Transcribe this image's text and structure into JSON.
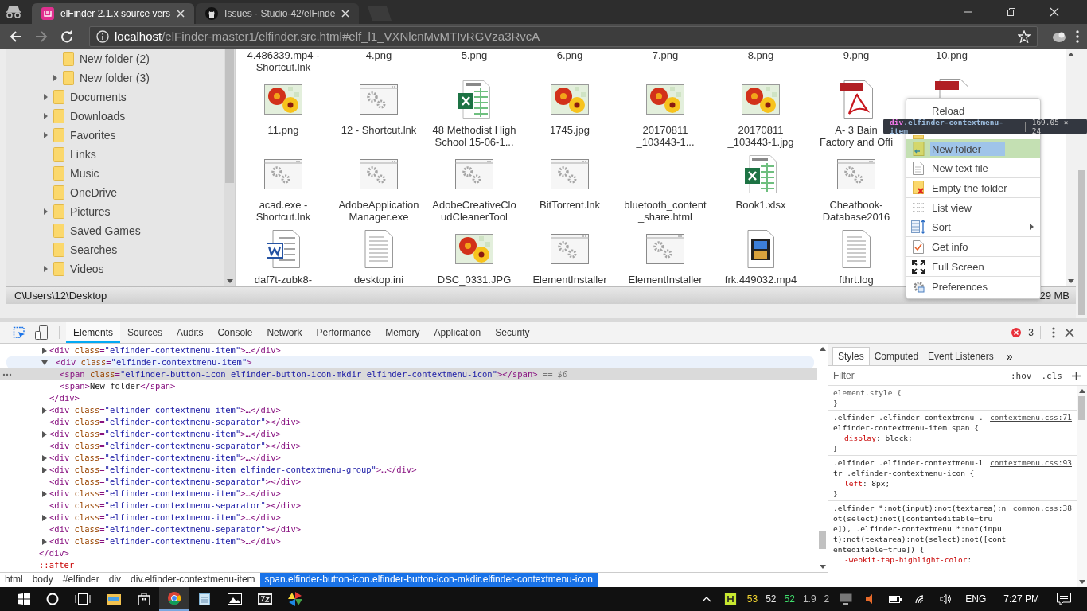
{
  "browser": {
    "tabs": [
      {
        "title": "elFinder 2.1.x source vers",
        "selected": true
      },
      {
        "title": "Issues · Studio-42/elFinde",
        "selected": false
      }
    ],
    "address": {
      "host": "localhost",
      "path": "/elFinder-master1/elfinder.src.html#elf_l1_VXNlcnMvMTIvRGVza3RvcA"
    }
  },
  "elfinder": {
    "tree": {
      "sub_items": [
        {
          "label": "New folder (2)",
          "expandable": false
        },
        {
          "label": "New folder (3)",
          "expandable": true
        }
      ],
      "items": [
        {
          "label": "Documents",
          "expandable": true
        },
        {
          "label": "Downloads",
          "expandable": true
        },
        {
          "label": "Favorites",
          "expandable": true
        },
        {
          "label": "Links",
          "expandable": false
        },
        {
          "label": "Music",
          "expandable": false
        },
        {
          "label": "OneDrive",
          "expandable": false
        },
        {
          "label": "Pictures",
          "expandable": true
        },
        {
          "label": "Saved Games",
          "expandable": false
        },
        {
          "label": "Searches",
          "expandable": false
        },
        {
          "label": "Videos",
          "expandable": true
        }
      ]
    },
    "file_rows": [
      [
        {
          "name": "4.486339.mp4 -\nShortcut.lnk",
          "kind": "scrolled"
        },
        {
          "name": "4.png",
          "kind": "scrolled"
        },
        {
          "name": "5.png",
          "kind": "scrolled"
        },
        {
          "name": "6.png",
          "kind": "scrolled"
        },
        {
          "name": "7.png",
          "kind": "scrolled"
        },
        {
          "name": "8.png",
          "kind": "scrolled"
        },
        {
          "name": "9.png",
          "kind": "scrolled"
        },
        {
          "name": "10.png",
          "kind": "scrolled"
        }
      ],
      [
        {
          "name": "11.png",
          "kind": "image"
        },
        {
          "name": "12 - Shortcut.lnk",
          "kind": "program"
        },
        {
          "name": "48 Methodist High\nSchool 15-06-1...",
          "kind": "spreadsheet"
        },
        {
          "name": "1745.jpg",
          "kind": "image"
        },
        {
          "name": "20170811\n_103443-1...",
          "kind": "image"
        },
        {
          "name": "20170811\n_103443-1.jpg",
          "kind": "image"
        },
        {
          "name": "A- 3 Bain\nFactory and Offi",
          "kind": "pdf"
        },
        {
          "kind": "pdftop"
        }
      ],
      [
        {
          "name": "acad.exe -\nShortcut.lnk",
          "kind": "program"
        },
        {
          "name": "AdobeApplication\nManager.exe",
          "kind": "program"
        },
        {
          "name": "AdobeCreativeClo\nudCleanerTool",
          "kind": "program"
        },
        {
          "name": "BitTorrent.lnk",
          "kind": "program"
        },
        {
          "name": "bluetooth_content\n_share.html",
          "kind": "none"
        },
        {
          "name": "Book1.xlsx",
          "kind": "spreadsheet"
        },
        {
          "name": "Cheatbook-\nDatabase2016",
          "kind": "program"
        }
      ],
      [
        {
          "name": "daf7t-zubk8-",
          "kind": "word"
        },
        {
          "name": "desktop.ini",
          "kind": "text"
        },
        {
          "name": "DSC_0331.JPG",
          "kind": "image"
        },
        {
          "name": "ElementInstaller",
          "kind": "program"
        },
        {
          "name": "ElementInstaller",
          "kind": "program"
        },
        {
          "name": "frk.449032.mp4",
          "kind": "video"
        },
        {
          "name": "fthrt.log",
          "kind": "text"
        }
      ]
    ],
    "status": {
      "path": "C\\Users\\12\\Desktop",
      "size": "29 MB"
    },
    "context_menu": [
      {
        "kind": "reload",
        "label": "Reload",
        "selected": false,
        "submenu": false
      },
      {
        "kind": "upload",
        "selected": false,
        "submenu": false
      },
      {
        "kind": "mkdir",
        "label": "New folder",
        "selected": true,
        "submenu": false
      },
      {
        "kind": "mkfile",
        "label": "New text file",
        "selected": false,
        "submenu": false
      },
      {
        "kind": "separator"
      },
      {
        "kind": "empty",
        "label": "Empty the folder",
        "selected": false,
        "submenu": false
      },
      {
        "kind": "separator"
      },
      {
        "kind": "view",
        "label": "List view",
        "selected": false,
        "submenu": false
      },
      {
        "kind": "sort",
        "label": "Sort",
        "selected": false,
        "submenu": true
      },
      {
        "kind": "separator"
      },
      {
        "kind": "info",
        "label": "Get info",
        "selected": false,
        "submenu": false
      },
      {
        "kind": "separator"
      },
      {
        "kind": "fullscreen",
        "label": "Full Screen",
        "selected": false,
        "submenu": false
      },
      {
        "kind": "separator"
      },
      {
        "kind": "preferences",
        "label": "Preferences",
        "selected": false,
        "submenu": false
      }
    ],
    "inspect_tooltip": {
      "tag": "div",
      "classes": ".elfinder-contextmenu-item",
      "size": "169.05 × 24"
    }
  },
  "devtools": {
    "tabs": [
      {
        "label": "Elements",
        "selected": true
      },
      {
        "label": "Sources",
        "selected": false
      },
      {
        "label": "Audits",
        "selected": false
      },
      {
        "label": "Console",
        "selected": false
      },
      {
        "label": "Network",
        "selected": false
      },
      {
        "label": "Performance",
        "selected": false
      },
      {
        "label": "Memory",
        "selected": false
      },
      {
        "label": "Application",
        "selected": false
      },
      {
        "label": "Security",
        "selected": false
      }
    ],
    "error_count": "3",
    "dom": {
      "nodes": [
        {
          "parts": [
            {
              "kind": "tag",
              "s": "<div"
            },
            {
              "kind": "attr",
              "s": " class"
            },
            {
              "kind": "tag",
              "s": "="
            },
            {
              "kind": "val",
              "s": "\"elfinder-contextmenu-item\""
            },
            {
              "kind": "tag",
              "s": ">…</div>"
            }
          ],
          "expandable": true,
          "expanded": false,
          "selected": false,
          "hovered": false
        },
        {
          "parts": [
            {
              "kind": "tag",
              "s": "<div"
            },
            {
              "kind": "attr",
              "s": " class"
            },
            {
              "kind": "tag",
              "s": "="
            },
            {
              "kind": "val",
              "s": "\"elfinder-contextmenu-item\""
            },
            {
              "kind": "tag",
              "s": ">"
            }
          ],
          "expandable": true,
          "expanded": true,
          "selected": false,
          "hovered": true,
          "children": [
            {
              "parts": [
                {
                  "kind": "tag",
                  "s": "<span"
                },
                {
                  "kind": "attr",
                  "s": " class"
                },
                {
                  "kind": "tag",
                  "s": "="
                },
                {
                  "kind": "val",
                  "s": "\"elfinder-button-icon elfinder-button-icon-mkdir elfinder-contextmenu-icon\""
                },
                {
                  "kind": "tag",
                  "s": "></span>"
                },
                {
                  "kind": "ref",
                  "s": " == $0"
                }
              ],
              "expandable": false,
              "selected": true,
              "hovered": false
            },
            {
              "parts": [
                {
                  "kind": "tag",
                  "s": "<span>"
                },
                {
                  "kind": "text",
                  "s": "New folder"
                },
                {
                  "kind": "tag",
                  "s": "</span>"
                }
              ],
              "expandable": false,
              "selected": false,
              "hovered": false
            }
          ],
          "closing": [
            {
              "kind": "tag",
              "s": "</div>"
            }
          ]
        },
        {
          "parts": [
            {
              "kind": "tag",
              "s": "<div"
            },
            {
              "kind": "attr",
              "s": " class"
            },
            {
              "kind": "tag",
              "s": "="
            },
            {
              "kind": "val",
              "s": "\"elfinder-contextmenu-item\""
            },
            {
              "kind": "tag",
              "s": ">…</div>"
            }
          ],
          "expandable": true,
          "expanded": false,
          "selected": false,
          "hovered": false
        },
        {
          "parts": [
            {
              "kind": "tag",
              "s": "<div"
            },
            {
              "kind": "attr",
              "s": " class"
            },
            {
              "kind": "tag",
              "s": "="
            },
            {
              "kind": "val",
              "s": "\"elfinder-contextmenu-separator\""
            },
            {
              "kind": "tag",
              "s": "></div>"
            }
          ],
          "expandable": false,
          "selected": false,
          "hovered": false
        },
        {
          "parts": [
            {
              "kind": "tag",
              "s": "<div"
            },
            {
              "kind": "attr",
              "s": " class"
            },
            {
              "kind": "tag",
              "s": "="
            },
            {
              "kind": "val",
              "s": "\"elfinder-contextmenu-item\""
            },
            {
              "kind": "tag",
              "s": ">…</div>"
            }
          ],
          "expandable": true,
          "expanded": false,
          "selected": false,
          "hovered": false
        },
        {
          "parts": [
            {
              "kind": "tag",
              "s": "<div"
            },
            {
              "kind": "attr",
              "s": " class"
            },
            {
              "kind": "tag",
              "s": "="
            },
            {
              "kind": "val",
              "s": "\"elfinder-contextmenu-separator\""
            },
            {
              "kind": "tag",
              "s": "></div>"
            }
          ],
          "expandable": false,
          "selected": false,
          "hovered": false
        },
        {
          "parts": [
            {
              "kind": "tag",
              "s": "<div"
            },
            {
              "kind": "attr",
              "s": " class"
            },
            {
              "kind": "tag",
              "s": "="
            },
            {
              "kind": "val",
              "s": "\"elfinder-contextmenu-item\""
            },
            {
              "kind": "tag",
              "s": ">…</div>"
            }
          ],
          "expandable": true,
          "expanded": false,
          "selected": false,
          "hovered": false
        },
        {
          "parts": [
            {
              "kind": "tag",
              "s": "<div"
            },
            {
              "kind": "attr",
              "s": " class"
            },
            {
              "kind": "tag",
              "s": "="
            },
            {
              "kind": "val",
              "s": "\"elfinder-contextmenu-item elfinder-contextmenu-group\""
            },
            {
              "kind": "tag",
              "s": ">…</div>"
            }
          ],
          "expandable": true,
          "expanded": false,
          "selected": false,
          "hovered": false
        },
        {
          "parts": [
            {
              "kind": "tag",
              "s": "<div"
            },
            {
              "kind": "attr",
              "s": " class"
            },
            {
              "kind": "tag",
              "s": "="
            },
            {
              "kind": "val",
              "s": "\"elfinder-contextmenu-separator\""
            },
            {
              "kind": "tag",
              "s": "></div>"
            }
          ],
          "expandable": false,
          "selected": false,
          "hovered": false
        },
        {
          "parts": [
            {
              "kind": "tag",
              "s": "<div"
            },
            {
              "kind": "attr",
              "s": " class"
            },
            {
              "kind": "tag",
              "s": "="
            },
            {
              "kind": "val",
              "s": "\"elfinder-contextmenu-item\""
            },
            {
              "kind": "tag",
              "s": ">…</div>"
            }
          ],
          "expandable": true,
          "expanded": false,
          "selected": false,
          "hovered": false
        },
        {
          "parts": [
            {
              "kind": "tag",
              "s": "<div"
            },
            {
              "kind": "attr",
              "s": " class"
            },
            {
              "kind": "tag",
              "s": "="
            },
            {
              "kind": "val",
              "s": "\"elfinder-contextmenu-separator\""
            },
            {
              "kind": "tag",
              "s": "></div>"
            }
          ],
          "expandable": false,
          "selected": false,
          "hovered": false
        },
        {
          "parts": [
            {
              "kind": "tag",
              "s": "<div"
            },
            {
              "kind": "attr",
              "s": " class"
            },
            {
              "kind": "tag",
              "s": "="
            },
            {
              "kind": "val",
              "s": "\"elfinder-contextmenu-item\""
            },
            {
              "kind": "tag",
              "s": ">…</div>"
            }
          ],
          "expandable": true,
          "expanded": false,
          "selected": false,
          "hovered": false
        },
        {
          "parts": [
            {
              "kind": "tag",
              "s": "<div"
            },
            {
              "kind": "attr",
              "s": " class"
            },
            {
              "kind": "tag",
              "s": "="
            },
            {
              "kind": "val",
              "s": "\"elfinder-contextmenu-separator\""
            },
            {
              "kind": "tag",
              "s": "></div>"
            }
          ],
          "expandable": false,
          "selected": false,
          "hovered": false
        },
        {
          "parts": [
            {
              "kind": "tag",
              "s": "<div"
            },
            {
              "kind": "attr",
              "s": " class"
            },
            {
              "kind": "tag",
              "s": "="
            },
            {
              "kind": "val",
              "s": "\"elfinder-contextmenu-item\""
            },
            {
              "kind": "tag",
              "s": ">…</div>"
            }
          ],
          "expandable": true,
          "expanded": false,
          "selected": false,
          "hovered": false
        }
      ],
      "after_lines": [
        [
          {
            "kind": "tag",
            "s": "</div>"
          }
        ],
        [
          {
            "kind": "pseudo",
            "s": "::after"
          }
        ]
      ]
    },
    "breadcrumbs": [
      {
        "label": "html",
        "selected": false
      },
      {
        "label": "body",
        "selected": false
      },
      {
        "label": "#elfinder",
        "selected": false
      },
      {
        "label": "div",
        "selected": false
      },
      {
        "label": "div.elfinder-contextmenu-item",
        "selected": false
      },
      {
        "label": "span.elfinder-button-icon.elfinder-button-icon-mkdir.elfinder-contextmenu-icon",
        "selected": true
      }
    ],
    "styles": {
      "tabs": [
        {
          "label": "Styles",
          "selected": true
        },
        {
          "label": "Computed",
          "selected": false
        },
        {
          "label": "Event Listeners",
          "selected": false
        }
      ],
      "more": "»",
      "filter_placeholder": "Filter",
      "hov": ":hov",
      "cls": ".cls",
      "rules": [
        {
          "selector": "element.style {",
          "close": "}"
        },
        {
          "selector": ".elfinder .elfinder-contextmenu .elfinder-contextmenu-item span {",
          "source": "contextmenu.css:71",
          "decls": [
            {
              "prop": "display",
              "rest": ": block;"
            }
          ],
          "close": "}"
        },
        {
          "selector": ".elfinder .elfinder-contextmenu-ltr .elfinder-contextmenu-icon {",
          "source": "contextmenu.css:93",
          "decls": [
            {
              "prop": "left",
              "rest": ": 8px;"
            }
          ],
          "close": "}"
        },
        {
          "selector": ".elfinder *:not(input):not(textarea):not(select):not([contenteditable=true]), .elfinder-contextmenu *:not(input):not(textarea):not(select):not([contenteditable=true]) {",
          "source": "common.css:38",
          "decls": [
            {
              "prop": "-webkit-tap-highlight-color",
              "rest": ":"
            }
          ]
        }
      ]
    }
  },
  "taskbar": {
    "apps": [
      {
        "kind": "explorer",
        "active": false
      },
      {
        "kind": "store",
        "active": false
      },
      {
        "kind": "chrome",
        "active": true
      },
      {
        "kind": "notepad",
        "active": false
      },
      {
        "kind": "photos",
        "active": false
      },
      {
        "kind": "archiver",
        "active": false
      },
      {
        "kind": "pinwheel",
        "active": false
      }
    ],
    "stats": [
      {
        "text": "53",
        "color": "#f2d530"
      },
      {
        "text": "52",
        "color": "#e6e6e6"
      },
      {
        "text": "52",
        "color": "#3fdc6b"
      },
      {
        "text": "1.9",
        "color": "#bdbdbd"
      },
      {
        "text": "2",
        "color": "#bdbdbd"
      }
    ],
    "language": "ENG",
    "time": "7:27 PM"
  }
}
